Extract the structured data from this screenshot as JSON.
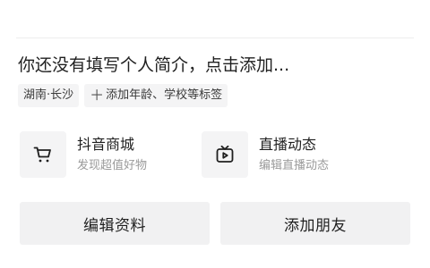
{
  "profile": {
    "bio_prompt": "你还没有填写个人简介，点击添加...",
    "tags": {
      "location": "湖南·长沙",
      "add_tag_icon": "plus-icon",
      "add_tag": "添加年龄、学校等标签"
    }
  },
  "entries": {
    "mall": {
      "icon": "shopping-cart-icon",
      "title": "抖音商城",
      "subtitle": "发现超值好物"
    },
    "live": {
      "icon": "tv-play-icon",
      "title": "直播动态",
      "subtitle": "编辑直播动态"
    }
  },
  "actions": {
    "edit_profile": "编辑资料",
    "add_friends": "添加朋友"
  },
  "colors": {
    "background": "#ffffff",
    "chip_background": "#f4f4f5",
    "button_background": "#f1f1f2",
    "primary_text": "#1f1f1f",
    "secondary_text": "#9a9a9a"
  }
}
